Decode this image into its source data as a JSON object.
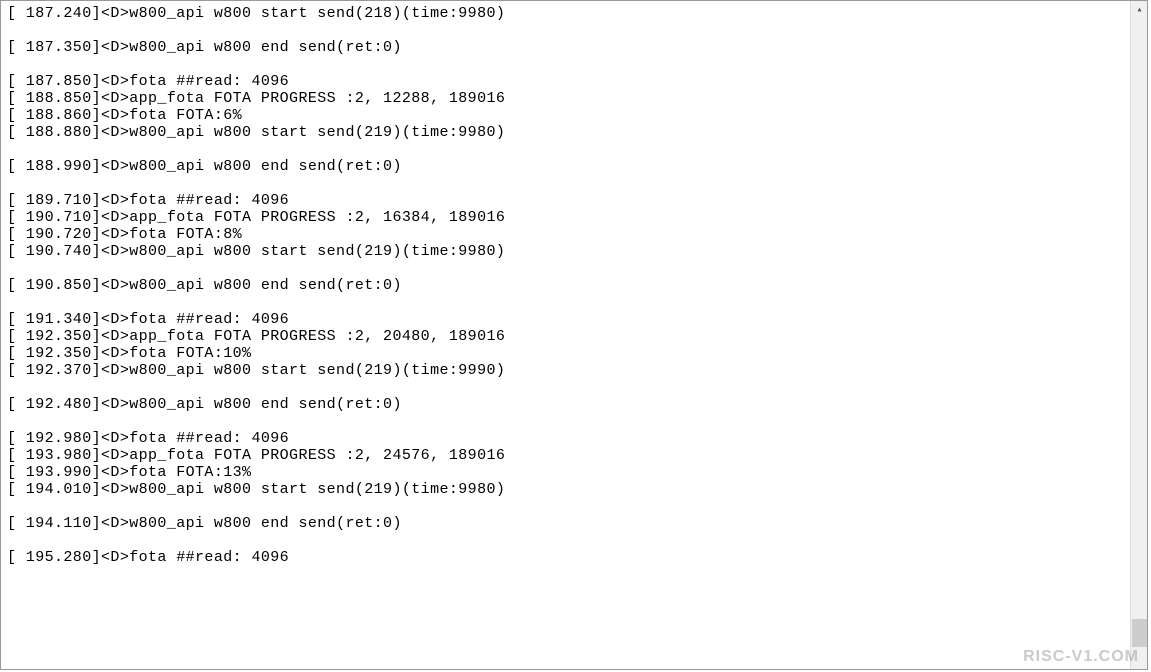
{
  "log": {
    "lines": [
      "[ 187.240]<D>w800_api w800 start send(218)(time:9980)",
      "",
      "[ 187.350]<D>w800_api w800 end send(ret:0)",
      "",
      "[ 187.850]<D>fota ##read: 4096",
      "[ 188.850]<D>app_fota FOTA PROGRESS :2, 12288, 189016",
      "[ 188.860]<D>fota FOTA:6%",
      "[ 188.880]<D>w800_api w800 start send(219)(time:9980)",
      "",
      "[ 188.990]<D>w800_api w800 end send(ret:0)",
      "",
      "[ 189.710]<D>fota ##read: 4096",
      "[ 190.710]<D>app_fota FOTA PROGRESS :2, 16384, 189016",
      "[ 190.720]<D>fota FOTA:8%",
      "[ 190.740]<D>w800_api w800 start send(219)(time:9980)",
      "",
      "[ 190.850]<D>w800_api w800 end send(ret:0)",
      "",
      "[ 191.340]<D>fota ##read: 4096",
      "[ 192.350]<D>app_fota FOTA PROGRESS :2, 20480, 189016",
      "[ 192.350]<D>fota FOTA:10%",
      "[ 192.370]<D>w800_api w800 start send(219)(time:9990)",
      "",
      "[ 192.480]<D>w800_api w800 end send(ret:0)",
      "",
      "[ 192.980]<D>fota ##read: 4096",
      "[ 193.980]<D>app_fota FOTA PROGRESS :2, 24576, 189016",
      "[ 193.990]<D>fota FOTA:13%",
      "[ 194.010]<D>w800_api w800 start send(219)(time:9980)",
      "",
      "[ 194.110]<D>w800_api w800 end send(ret:0)",
      "",
      "[ 195.280]<D>fota ##read: 4096"
    ]
  },
  "watermark": "RISC-V1.COM",
  "scrollbar": {
    "arrow_up_glyph": "▴"
  }
}
